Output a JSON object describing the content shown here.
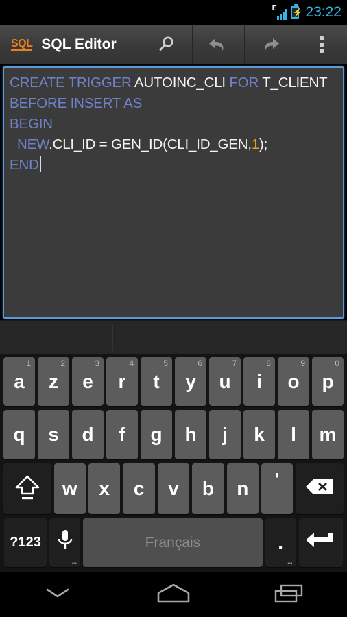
{
  "statusbar": {
    "network_type": "E",
    "signal_icon": "signal-bars-icon",
    "battery_icon": "battery-charging-icon",
    "clock": "23:22"
  },
  "actionbar": {
    "logo_text": "SQL",
    "title": "SQL Editor",
    "buttons": [
      {
        "name": "search-button",
        "icon": "search-icon"
      },
      {
        "name": "undo-button",
        "icon": "undo-arrow-icon"
      },
      {
        "name": "redo-button",
        "icon": "redo-arrow-icon"
      },
      {
        "name": "overflow-menu-button",
        "icon": "overflow-menu-icon"
      }
    ]
  },
  "editor": {
    "focused": true,
    "border_color": "#5a9ad6",
    "background_color": "#3b3b3b",
    "keyword_color": "#6e82c8",
    "number_color": "#e8a317",
    "text_color": "#f2f2f2",
    "lines": [
      "CREATE TRIGGER AUTOINC_CLI FOR T_CLIENT",
      "BEFORE INSERT AS",
      "BEGIN",
      "   NEW.CLI_ID = GEN_ID(CLI_ID_GEN,1);",
      "END"
    ],
    "l1_kw1": "CREATE TRIGGER ",
    "l1_id1": "AUTOINC_CLI ",
    "l1_kw2": "FOR ",
    "l1_id2": "T_CLIENT",
    "l2_kw": "BEFORE INSERT AS",
    "l3_kw": "BEGIN",
    "l4_kw": "  NEW",
    "l4_mid": ".CLI_ID = GEN_ID(CLI_ID_GEN,",
    "l4_num": "1",
    "l4_end": ");",
    "l5_kw": "END"
  },
  "suggestion_strip": {
    "suggestions": [
      "",
      "",
      ""
    ]
  },
  "keyboard": {
    "layout": "AZERTY",
    "language_label": "Français",
    "row1": [
      {
        "label": "a",
        "hint": "1"
      },
      {
        "label": "z",
        "hint": "2"
      },
      {
        "label": "e",
        "hint": "3"
      },
      {
        "label": "r",
        "hint": "4"
      },
      {
        "label": "t",
        "hint": "5"
      },
      {
        "label": "y",
        "hint": "6"
      },
      {
        "label": "u",
        "hint": "7"
      },
      {
        "label": "i",
        "hint": "8"
      },
      {
        "label": "o",
        "hint": "9"
      },
      {
        "label": "p",
        "hint": "0"
      }
    ],
    "row2": [
      {
        "label": "q"
      },
      {
        "label": "s"
      },
      {
        "label": "d"
      },
      {
        "label": "f"
      },
      {
        "label": "g"
      },
      {
        "label": "h"
      },
      {
        "label": "j"
      },
      {
        "label": "k"
      },
      {
        "label": "l"
      },
      {
        "label": "m"
      }
    ],
    "row3_letters": [
      {
        "label": "w"
      },
      {
        "label": "x"
      },
      {
        "label": "c"
      },
      {
        "label": "v"
      },
      {
        "label": "b"
      },
      {
        "label": "n"
      },
      {
        "label": "'"
      }
    ],
    "shift_key": {
      "name": "shift-key",
      "icon": "shift-arrow-icon"
    },
    "backspace_key": {
      "name": "backspace-key",
      "icon": "backspace-icon"
    },
    "symbols_key": {
      "label": "?123"
    },
    "mic_key": {
      "name": "microphone-key",
      "icon": "microphone-icon",
      "hint": "..."
    },
    "period_key": {
      "label": ".",
      "hint": "..."
    },
    "enter_key": {
      "name": "enter-key",
      "icon": "enter-return-icon"
    }
  },
  "navbar": {
    "back": {
      "name": "back-hide-keyboard-button",
      "icon": "chevron-down-icon"
    },
    "home": {
      "name": "home-button",
      "icon": "home-pentagon-icon"
    },
    "recents": {
      "name": "recent-apps-button",
      "icon": "recent-apps-icon"
    }
  }
}
